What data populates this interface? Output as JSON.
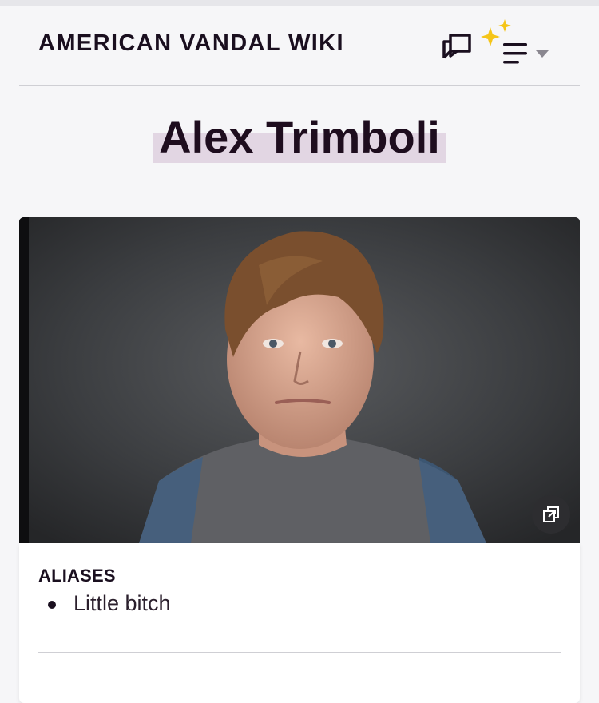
{
  "header": {
    "wiki_name": "AMERICAN VANDAL WIKI",
    "icons": [
      "discussion-icon",
      "sparkle-icon",
      "menu-icon",
      "caret-down-icon"
    ],
    "accent_color": "#f5c518"
  },
  "page": {
    "title": "Alex Trimboli",
    "title_highlight_color": "#e2d6e3"
  },
  "infobox": {
    "image_alt": "Alex Trimboli",
    "expand_icon": "expand-image-icon",
    "fields": [
      {
        "label": "ALIASES",
        "values": [
          "Little bitch"
        ]
      }
    ]
  }
}
